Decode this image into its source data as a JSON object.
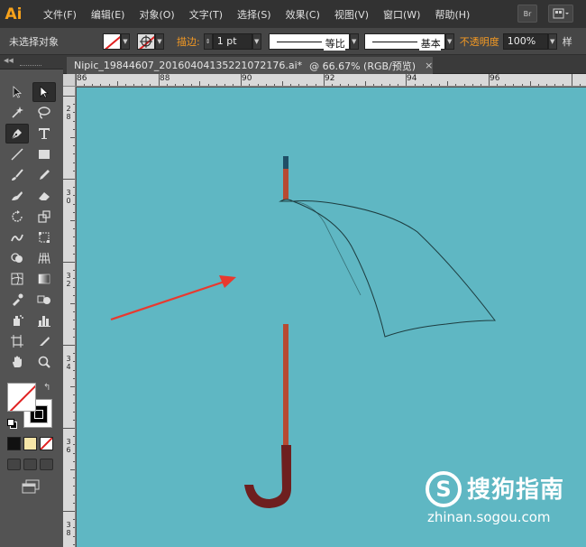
{
  "app": {
    "logo": "Ai"
  },
  "menu": {
    "items": [
      "文件(F)",
      "编辑(E)",
      "对象(O)",
      "文字(T)",
      "选择(S)",
      "效果(C)",
      "视图(V)",
      "窗口(W)",
      "帮助(H)"
    ],
    "bridge_label": "Br"
  },
  "control_bar": {
    "selection_status": "未选择对象",
    "stroke_label": "描边:",
    "stroke_weight": "1 pt",
    "stroke_style_1": "等比",
    "stroke_style_2": "基本",
    "opacity_label": "不透明度",
    "opacity_value": "100%",
    "style_label": "样"
  },
  "document": {
    "tab_title": "Nipic_19844607_20160404135221072176.ai*",
    "zoom_info": "@ 66.67% (RGB/预览)",
    "close_glyph": "×"
  },
  "rulers": {
    "horizontal_labels": [
      "86",
      "88",
      "90",
      "92",
      "94",
      "96"
    ],
    "vertical_labels": [
      "2\n8",
      "3\n0",
      "3\n2",
      "3\n4",
      "3\n6",
      "3\n8"
    ]
  },
  "canvas": {
    "background_color": "#5fb7c3",
    "arrow_color": "#e8392f",
    "handle_color": "#b74a32",
    "hook_color": "#6e1f1f"
  },
  "toolbar": {
    "tools": [
      "selection-icon",
      "direct-selection-icon",
      "magic-wand-icon",
      "lasso-icon",
      "pen-icon",
      "type-icon",
      "line-icon",
      "rectangle-icon",
      "paintbrush-icon",
      "pencil-icon",
      "blob-brush-icon",
      "eraser-icon",
      "rotate-icon",
      "scale-icon",
      "warp-icon",
      "free-transform-icon",
      "shape-builder-icon",
      "perspective-grid-icon",
      "mesh-icon",
      "gradient-icon",
      "eyedropper-icon",
      "blend-icon",
      "symbol-sprayer-icon",
      "column-graph-icon",
      "artboard-icon",
      "slice-icon",
      "hand-icon",
      "zoom-icon"
    ]
  },
  "watermark": {
    "logo_glyph": "S",
    "name": "搜狗指南",
    "url": "zhinan.sogou.com"
  }
}
